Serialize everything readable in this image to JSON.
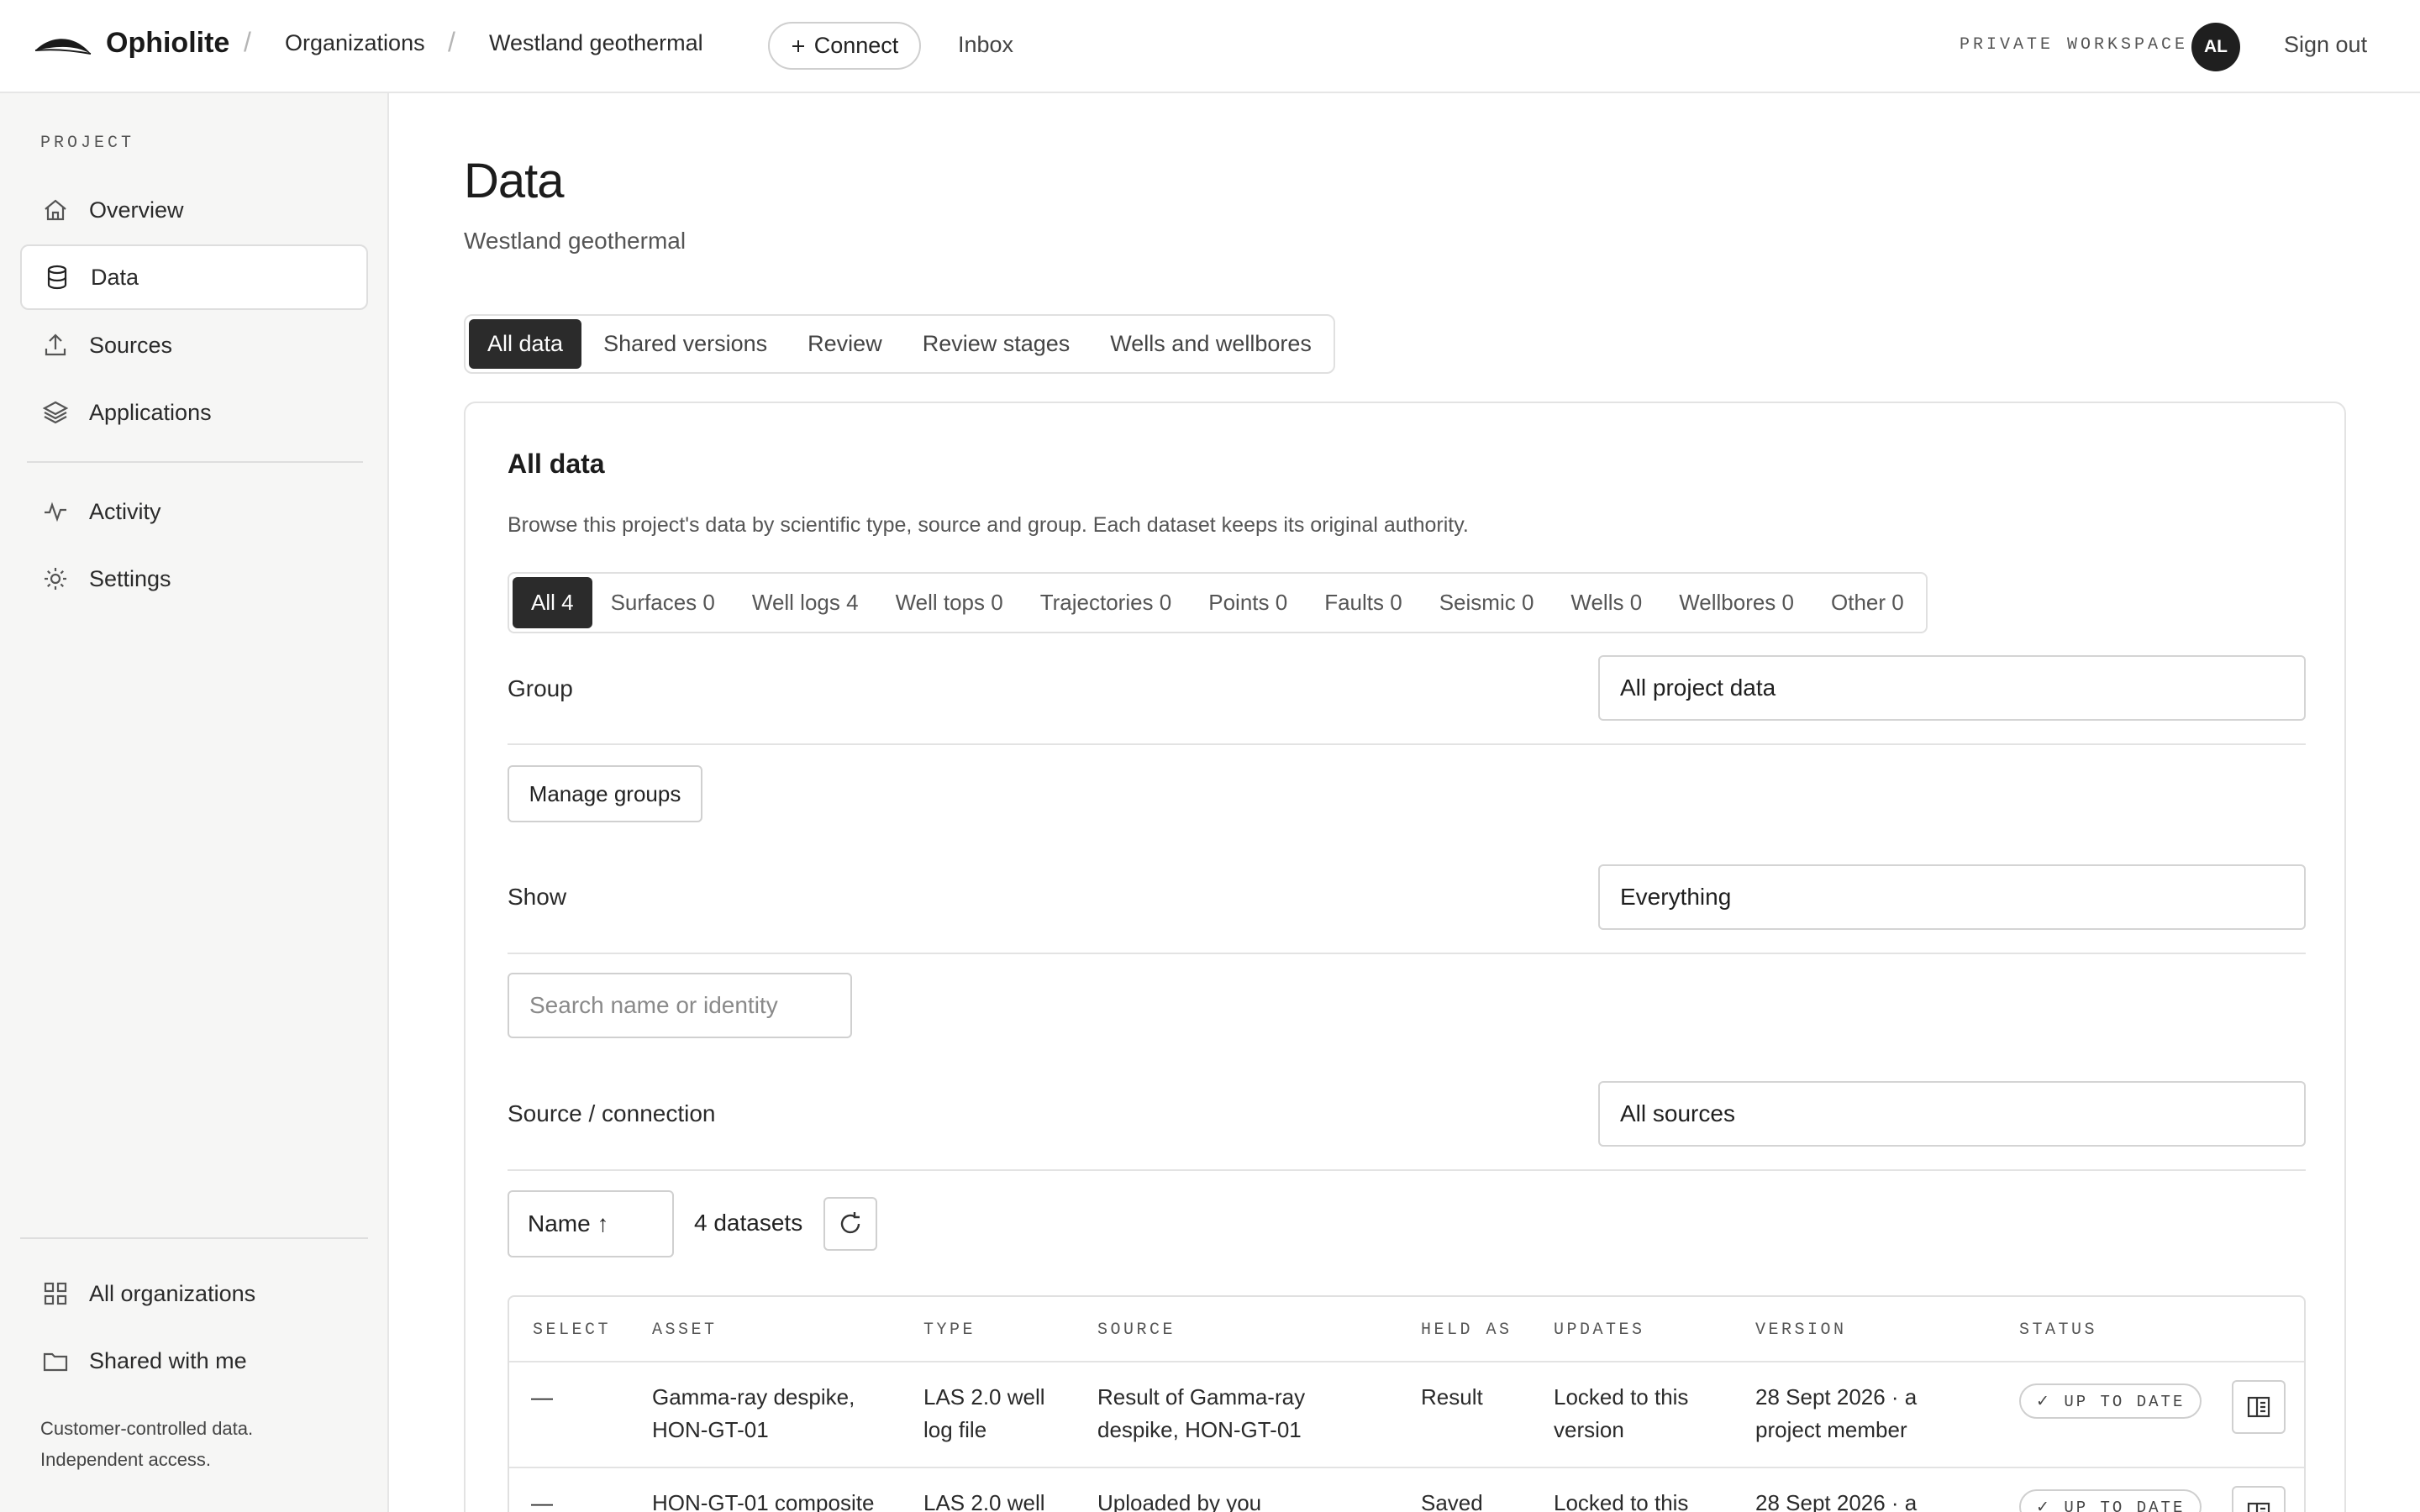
{
  "header": {
    "brand": "Ophiolite",
    "breadcrumb": [
      "Organizations",
      "Westland geothermal"
    ],
    "separator": "/",
    "connect_label": "Connect",
    "connect_icon": "plus-icon",
    "inbox_label": "Inbox",
    "workspace_label": "PRIVATE WORKSPACE",
    "avatar_initials": "AL",
    "signout_label": "Sign out"
  },
  "sidebar": {
    "heading": "PROJECT",
    "items": [
      {
        "label": "Overview",
        "icon": "home-icon",
        "active": false
      },
      {
        "label": "Data",
        "icon": "database-icon",
        "active": true
      },
      {
        "label": "Sources",
        "icon": "upload-icon",
        "active": false
      },
      {
        "label": "Applications",
        "icon": "layers-icon",
        "active": false
      },
      {
        "label": "Activity",
        "icon": "activity-icon",
        "active": false
      },
      {
        "label": "Settings",
        "icon": "sun-icon",
        "active": false
      }
    ],
    "bottom_items": [
      {
        "label": "All organizations",
        "icon": "grid-icon"
      },
      {
        "label": "Shared with me",
        "icon": "folder-icon"
      }
    ],
    "footer_lines": [
      "Customer-controlled data.",
      "Independent access."
    ]
  },
  "page": {
    "title": "Data",
    "subtitle": "Westland geothermal",
    "tabs": [
      {
        "label": "All data",
        "active": true
      },
      {
        "label": "Shared versions",
        "active": false
      },
      {
        "label": "Review",
        "active": false
      },
      {
        "label": "Review stages",
        "active": false
      },
      {
        "label": "Wells and wellbores",
        "active": false
      }
    ]
  },
  "card": {
    "title": "All data",
    "description": "Browse this project's data by scientific type, source and group. Each dataset keeps its original authority.",
    "filters": [
      {
        "label": "All 4",
        "active": true
      },
      {
        "label": "Surfaces 0",
        "active": false
      },
      {
        "label": "Well logs 4",
        "active": false
      },
      {
        "label": "Well tops 0",
        "active": false
      },
      {
        "label": "Trajectories 0",
        "active": false
      },
      {
        "label": "Points 0",
        "active": false
      },
      {
        "label": "Faults 0",
        "active": false
      },
      {
        "label": "Seismic 0",
        "active": false
      },
      {
        "label": "Wells 0",
        "active": false
      },
      {
        "label": "Wellbores 0",
        "active": false
      },
      {
        "label": "Other 0",
        "active": false
      }
    ],
    "group_label": "Group",
    "group_value": "All project data",
    "manage_groups_label": "Manage groups",
    "show_label": "Show",
    "show_value": "Everything",
    "search_placeholder": "Search name or identity",
    "source_label": "Source / connection",
    "source_value": "All sources",
    "sort_label": "Name ↑",
    "dataset_count": "4 datasets",
    "refresh_icon": "refresh-icon"
  },
  "table": {
    "columns": [
      "SELECT",
      "ASSET",
      "TYPE",
      "SOURCE",
      "HELD AS",
      "UPDATES",
      "VERSION",
      "STATUS"
    ],
    "rows": [
      {
        "select": "—",
        "asset": [
          "Gamma-ray despike,",
          "HON-GT-01"
        ],
        "type": [
          "LAS 2.0 well",
          "log file"
        ],
        "source": [
          "Result of Gamma-ray",
          "despike, HON-GT-01"
        ],
        "held_as": "Result",
        "updates": [
          "Locked to this",
          "version"
        ],
        "version": [
          "28 Sept 2026 · a",
          "project member"
        ],
        "status": "✓ UP TO DATE",
        "action_icon": "panel-icon"
      },
      {
        "select": "—",
        "asset": [
          "HON-GT-01 composite",
          ""
        ],
        "type": [
          "LAS 2.0 well",
          ""
        ],
        "source": [
          "Uploaded by you",
          ""
        ],
        "held_as": "Saved",
        "updates": [
          "Locked to this",
          ""
        ],
        "version": [
          "28 Sept 2026 · a",
          ""
        ],
        "status": "✓ UP TO DATE",
        "action_icon": "panel-icon"
      }
    ]
  },
  "colors": {
    "accent_dark": "#2b2b2b",
    "sidebar_bg": "#f6f6f5",
    "border": "#e0e0e0"
  }
}
